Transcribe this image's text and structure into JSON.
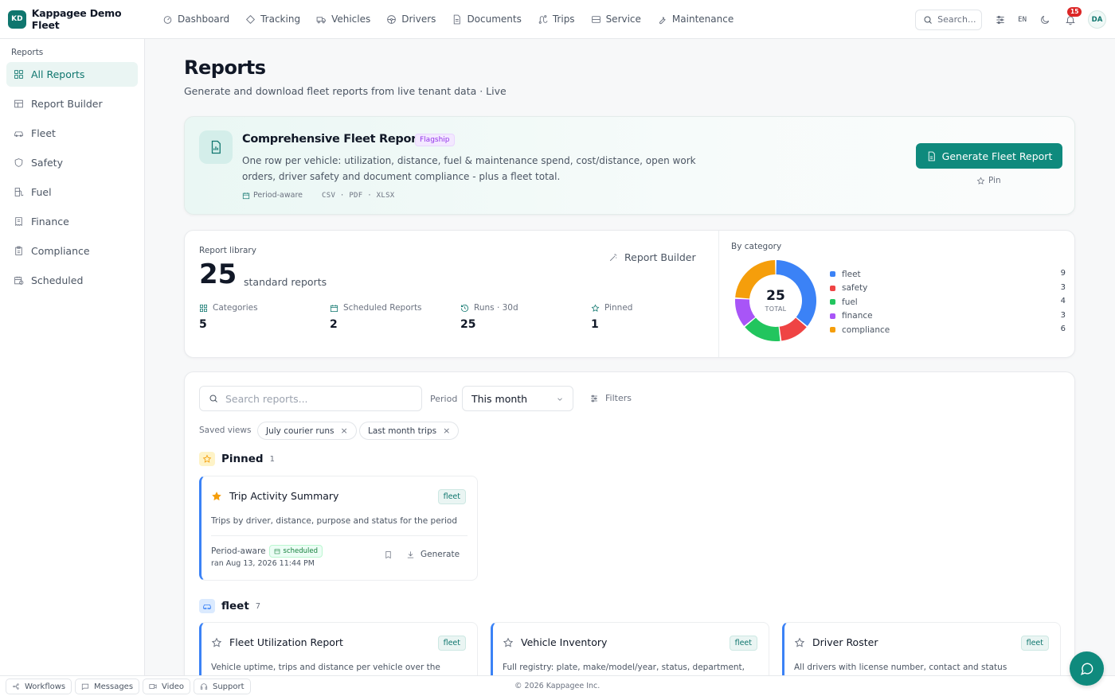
{
  "brand": {
    "initials": "KD",
    "name": "Kappagee Demo Fleet"
  },
  "nav": [
    {
      "label": "Dashboard",
      "icon": "dashboard-icon"
    },
    {
      "label": "Tracking",
      "icon": "tracking-icon"
    },
    {
      "label": "Vehicles",
      "icon": "truck-icon"
    },
    {
      "label": "Drivers",
      "icon": "steering-wheel-icon"
    },
    {
      "label": "Documents",
      "icon": "document-icon"
    },
    {
      "label": "Trips",
      "icon": "route-icon"
    },
    {
      "label": "Service",
      "icon": "service-icon"
    },
    {
      "label": "Maintenance",
      "icon": "wrench-icon"
    }
  ],
  "topbar": {
    "search_placeholder": "Search...",
    "language": "EN",
    "notification_count": "15",
    "user_initials": "DA"
  },
  "sidebar": {
    "title": "Reports",
    "items": [
      {
        "label": "All Reports",
        "icon": "grid-icon",
        "active": true
      },
      {
        "label": "Report Builder",
        "icon": "builder-icon"
      },
      {
        "label": "Fleet",
        "icon": "car-icon"
      },
      {
        "label": "Safety",
        "icon": "shield-icon"
      },
      {
        "label": "Fuel",
        "icon": "fuel-icon"
      },
      {
        "label": "Finance",
        "icon": "receipt-icon"
      },
      {
        "label": "Compliance",
        "icon": "clipboard-icon"
      },
      {
        "label": "Scheduled",
        "icon": "calendar-clock-icon"
      }
    ]
  },
  "page": {
    "title": "Reports",
    "subtitle": "Generate and download fleet reports from live tenant data · Live"
  },
  "flagship": {
    "title": "Comprehensive Fleet Report",
    "badge": "Flagship",
    "description": "One row per vehicle: utilization, distance, fuel & maintenance spend, cost/distance, open work orders, driver safety and document compliance - plus a fleet total.",
    "period_aware": "Period-aware",
    "formats": "CSV · PDF · XLSX",
    "generate_label": "Generate Fleet Report",
    "pin_label": "Pin"
  },
  "library": {
    "label": "Report library",
    "count": "25",
    "suffix": "standard reports",
    "builder_link": "Report Builder",
    "stats": [
      {
        "label": "Categories",
        "value": "5",
        "icon": "grid-icon"
      },
      {
        "label": "Scheduled Reports",
        "value": "2",
        "icon": "calendar-icon"
      },
      {
        "label": "Runs · 30d",
        "value": "25",
        "icon": "history-icon"
      },
      {
        "label": "Pinned",
        "value": "1",
        "icon": "star-icon"
      }
    ]
  },
  "category_title": "By category",
  "chart_data": {
    "type": "pie",
    "title": "By category",
    "center_total": "25",
    "center_label": "TOTAL",
    "categories": [
      "fleet",
      "safety",
      "fuel",
      "finance",
      "compliance"
    ],
    "values": [
      9,
      3,
      4,
      3,
      6
    ],
    "colors": [
      "#3b82f6",
      "#ef4444",
      "#22c55e",
      "#a855f7",
      "#f59e0b"
    ]
  },
  "filters": {
    "search_placeholder": "Search reports...",
    "period_label": "Period",
    "period_value": "This month",
    "filters_label": "Filters",
    "saved_views_label": "Saved views",
    "saved_views": [
      "July courier runs",
      "Last month trips"
    ]
  },
  "pinned_section": {
    "title": "Pinned",
    "count": "1",
    "card": {
      "title": "Trip Activity Summary",
      "badge": "fleet",
      "description": "Trips by driver, distance, purpose and status for the period",
      "period_aware": "Period-aware",
      "scheduled": "scheduled",
      "last_run": "ran Aug 13, 2026 11:44 PM",
      "generate": "Generate"
    }
  },
  "fleet_section": {
    "title": "fleet",
    "count": "7",
    "cards": [
      {
        "title": "Fleet Utilization Report",
        "badge": "fleet",
        "description": "Vehicle uptime, trips and distance per vehicle over the"
      },
      {
        "title": "Vehicle Inventory",
        "badge": "fleet",
        "description": "Full registry: plate, make/model/year, status, department,"
      },
      {
        "title": "Driver Roster",
        "badge": "fleet",
        "description": "All drivers with license number, contact and status"
      }
    ]
  },
  "bottombar": {
    "items": [
      {
        "label": "Workflows",
        "icon": "workflow-icon"
      },
      {
        "label": "Messages",
        "icon": "message-icon"
      },
      {
        "label": "Video",
        "icon": "video-icon"
      },
      {
        "label": "Support",
        "icon": "headset-icon"
      }
    ],
    "copyright": "© 2026 Kappagee Inc."
  }
}
